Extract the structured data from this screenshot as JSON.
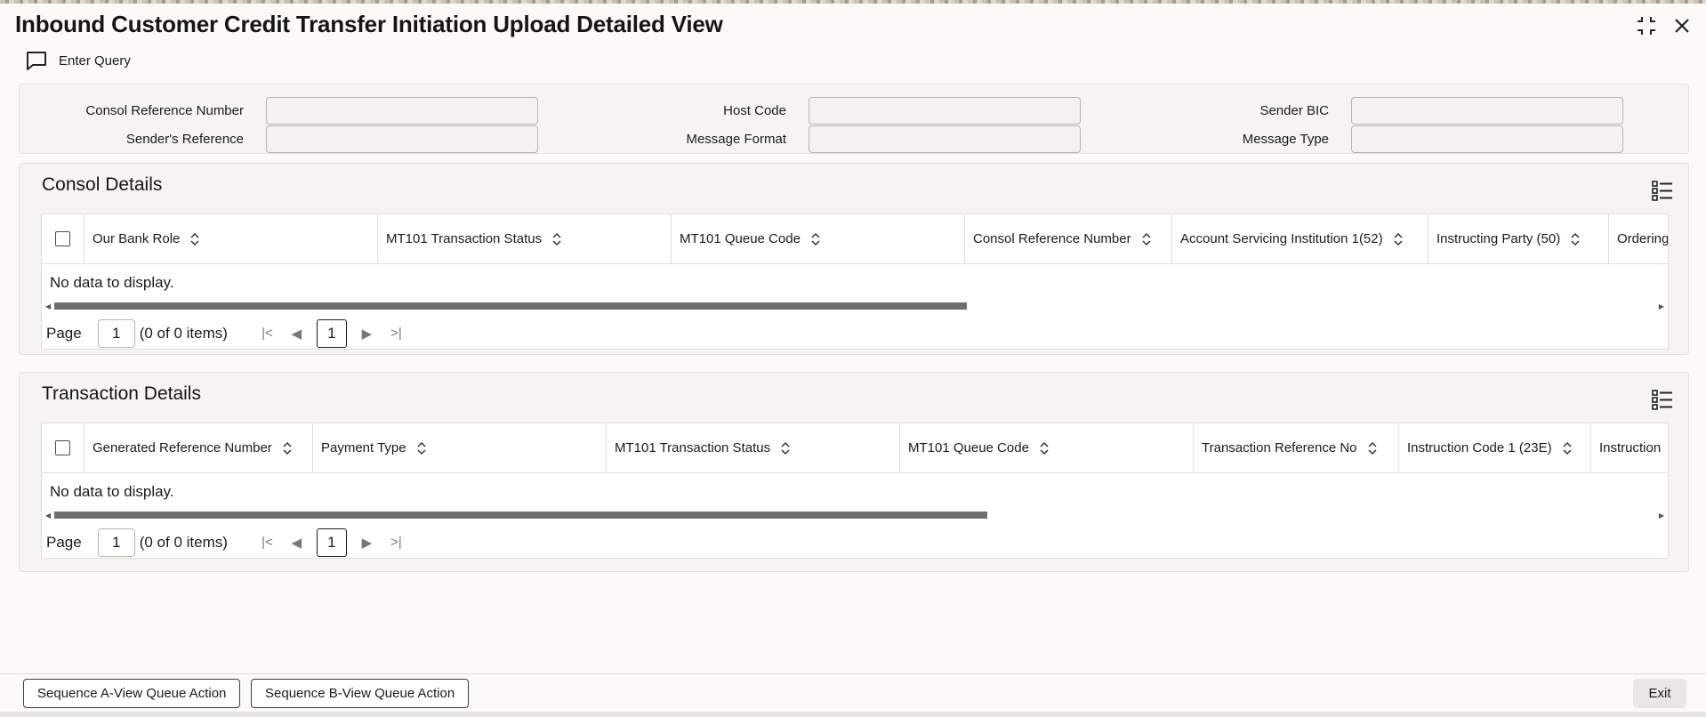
{
  "window": {
    "title": "Inbound Customer Credit Transfer Initiation Upload Detailed View",
    "enter_query": "Enter Query"
  },
  "query": {
    "fields": [
      {
        "label": "Consol Reference Number",
        "value": ""
      },
      {
        "label": "Host Code",
        "value": ""
      },
      {
        "label": "Sender BIC",
        "value": ""
      },
      {
        "label": "Sender's Reference",
        "value": ""
      },
      {
        "label": "Message Format",
        "value": ""
      },
      {
        "label": "Message Type",
        "value": ""
      }
    ]
  },
  "consol": {
    "title": "Consol Details",
    "columns": [
      "Our Bank Role",
      "MT101 Transaction Status",
      "MT101 Queue Code",
      "Consol Reference Number",
      "Account Servicing Institution 1(52)",
      "Instructing Party (50)",
      "Ordering"
    ],
    "empty": "No data to display.",
    "pager": {
      "label": "Page",
      "page": "1",
      "items": "(0 of 0 items)",
      "current": "1"
    }
  },
  "transaction": {
    "title": "Transaction Details",
    "columns": [
      "Generated Reference Number",
      "Payment Type",
      "MT101 Transaction Status",
      "MT101 Queue Code",
      "Transaction Reference No",
      "Instruction Code 1 (23E)",
      "Instruction"
    ],
    "empty": "No data to display.",
    "pager": {
      "label": "Page",
      "page": "1",
      "items": "(0 of 0 items)",
      "current": "1"
    }
  },
  "footer": {
    "seq_a": "Sequence A-View Queue Action",
    "seq_b": "Sequence B-View Queue Action",
    "exit": "Exit"
  }
}
